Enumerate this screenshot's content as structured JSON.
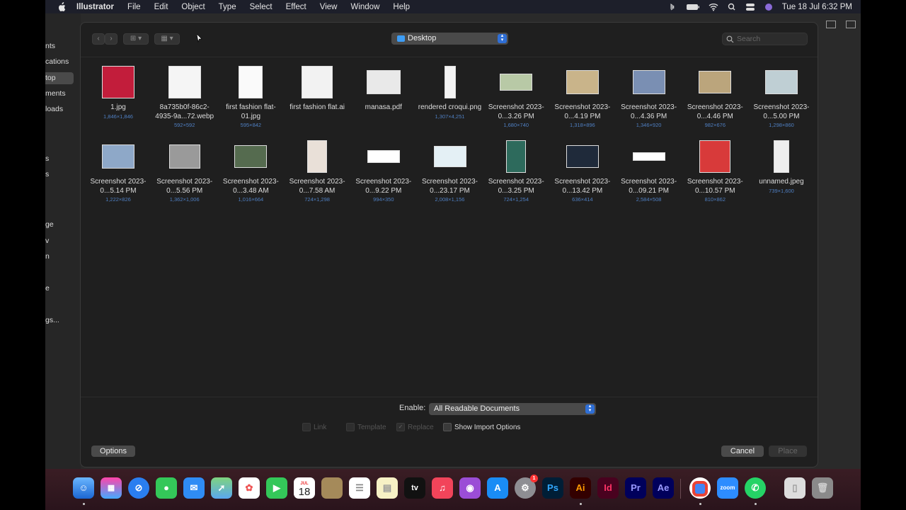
{
  "menubar": {
    "app_name": "Illustrator",
    "items": [
      "File",
      "Edit",
      "Object",
      "Type",
      "Select",
      "Effect",
      "View",
      "Window",
      "Help"
    ],
    "clock": "Tue 18 Jul  6:32 PM"
  },
  "sidebar": {
    "items": [
      "nts",
      "cations",
      "top",
      "ments",
      "loads",
      "",
      "s",
      "s",
      "ge",
      "v",
      "n",
      "e",
      "gs..."
    ],
    "selected_index": 2
  },
  "dialog": {
    "location": "Desktop",
    "search_placeholder": "Search",
    "files": [
      {
        "name": "1.jpg",
        "dims": "1,846×1,846",
        "icon": "portrait-photo-icon"
      },
      {
        "name": "8a735b0f-86c2-4935-9a...72.webp",
        "dims": "592×592",
        "icon": "shoe-photo-icon"
      },
      {
        "name": "first fashion flat-01.jpg",
        "dims": "595×842",
        "icon": "fashion-flat-icon"
      },
      {
        "name": "first fashion flat.ai",
        "dims": "",
        "icon": "ai-file-icon"
      },
      {
        "name": "manasa.pdf",
        "dims": "",
        "icon": "pdf-file-icon"
      },
      {
        "name": "rendered croqui.png",
        "dims": "1,307×4,251",
        "icon": "croqui-icon"
      },
      {
        "name": "Screenshot 2023-0...3.26 PM",
        "dims": "1,680×740",
        "icon": "screenshot-icon"
      },
      {
        "name": "Screenshot 2023-0...4.19 PM",
        "dims": "1,318×896",
        "icon": "screenshot-icon"
      },
      {
        "name": "Screenshot 2023-0...4.36 PM",
        "dims": "1,346×920",
        "icon": "screenshot-icon"
      },
      {
        "name": "Screenshot 2023-0...4.46 PM",
        "dims": "982×676",
        "icon": "screenshot-icon"
      },
      {
        "name": "Screenshot 2023-0...5.00 PM",
        "dims": "1,298×860",
        "icon": "screenshot-icon"
      },
      {
        "name": "Screenshot 2023-0...5.14 PM",
        "dims": "1,222×826",
        "icon": "screenshot-icon"
      },
      {
        "name": "Screenshot 2023-0...5.56 PM",
        "dims": "1,362×1,006",
        "icon": "screenshot-icon"
      },
      {
        "name": "Screenshot 2023-0...3.48 AM",
        "dims": "1,016×664",
        "icon": "screenshot-icon"
      },
      {
        "name": "Screenshot 2023-0...7.58 AM",
        "dims": "724×1,298",
        "icon": "screenshot-icon"
      },
      {
        "name": "Screenshot 2023-0...9.22 PM",
        "dims": "994×350",
        "icon": "screenshot-icon"
      },
      {
        "name": "Screenshot 2023-0...23.17 PM",
        "dims": "2,008×1,156",
        "icon": "screenshot-icon"
      },
      {
        "name": "Screenshot 2023-0...3.25 PM",
        "dims": "724×1,254",
        "icon": "screenshot-icon"
      },
      {
        "name": "Screenshot 2023-0...13.42 PM",
        "dims": "636×414",
        "icon": "screenshot-icon"
      },
      {
        "name": "Screenshot 2023-0...09.21 PM",
        "dims": "2,584×508",
        "icon": "screenshot-icon"
      },
      {
        "name": "Screenshot 2023-0...10.57 PM",
        "dims": "810×862",
        "icon": "screenshot-icon"
      },
      {
        "name": "unnamed.jpeg",
        "dims": "739×1,600",
        "icon": "qr-photo-icon"
      }
    ],
    "enable_label": "Enable:",
    "enable_value": "All Readable Documents",
    "checkboxes": [
      {
        "label": "Link",
        "enabled": false,
        "checked": false
      },
      {
        "label": "Template",
        "enabled": false,
        "checked": false
      },
      {
        "label": "Replace",
        "enabled": false,
        "checked": true
      },
      {
        "label": "Show Import Options",
        "enabled": true,
        "checked": false
      }
    ],
    "options_label": "Options",
    "cancel_label": "Cancel",
    "place_label": "Place"
  },
  "dock": {
    "calendar_month": "JUL",
    "calendar_day": "18",
    "tv_label": "tv",
    "ps_label": "Ps",
    "ai_label": "Ai",
    "id_label": "Id",
    "pr_label": "Pr",
    "ae_label": "Ae",
    "zoom_label": "zoom",
    "badge": "1"
  }
}
